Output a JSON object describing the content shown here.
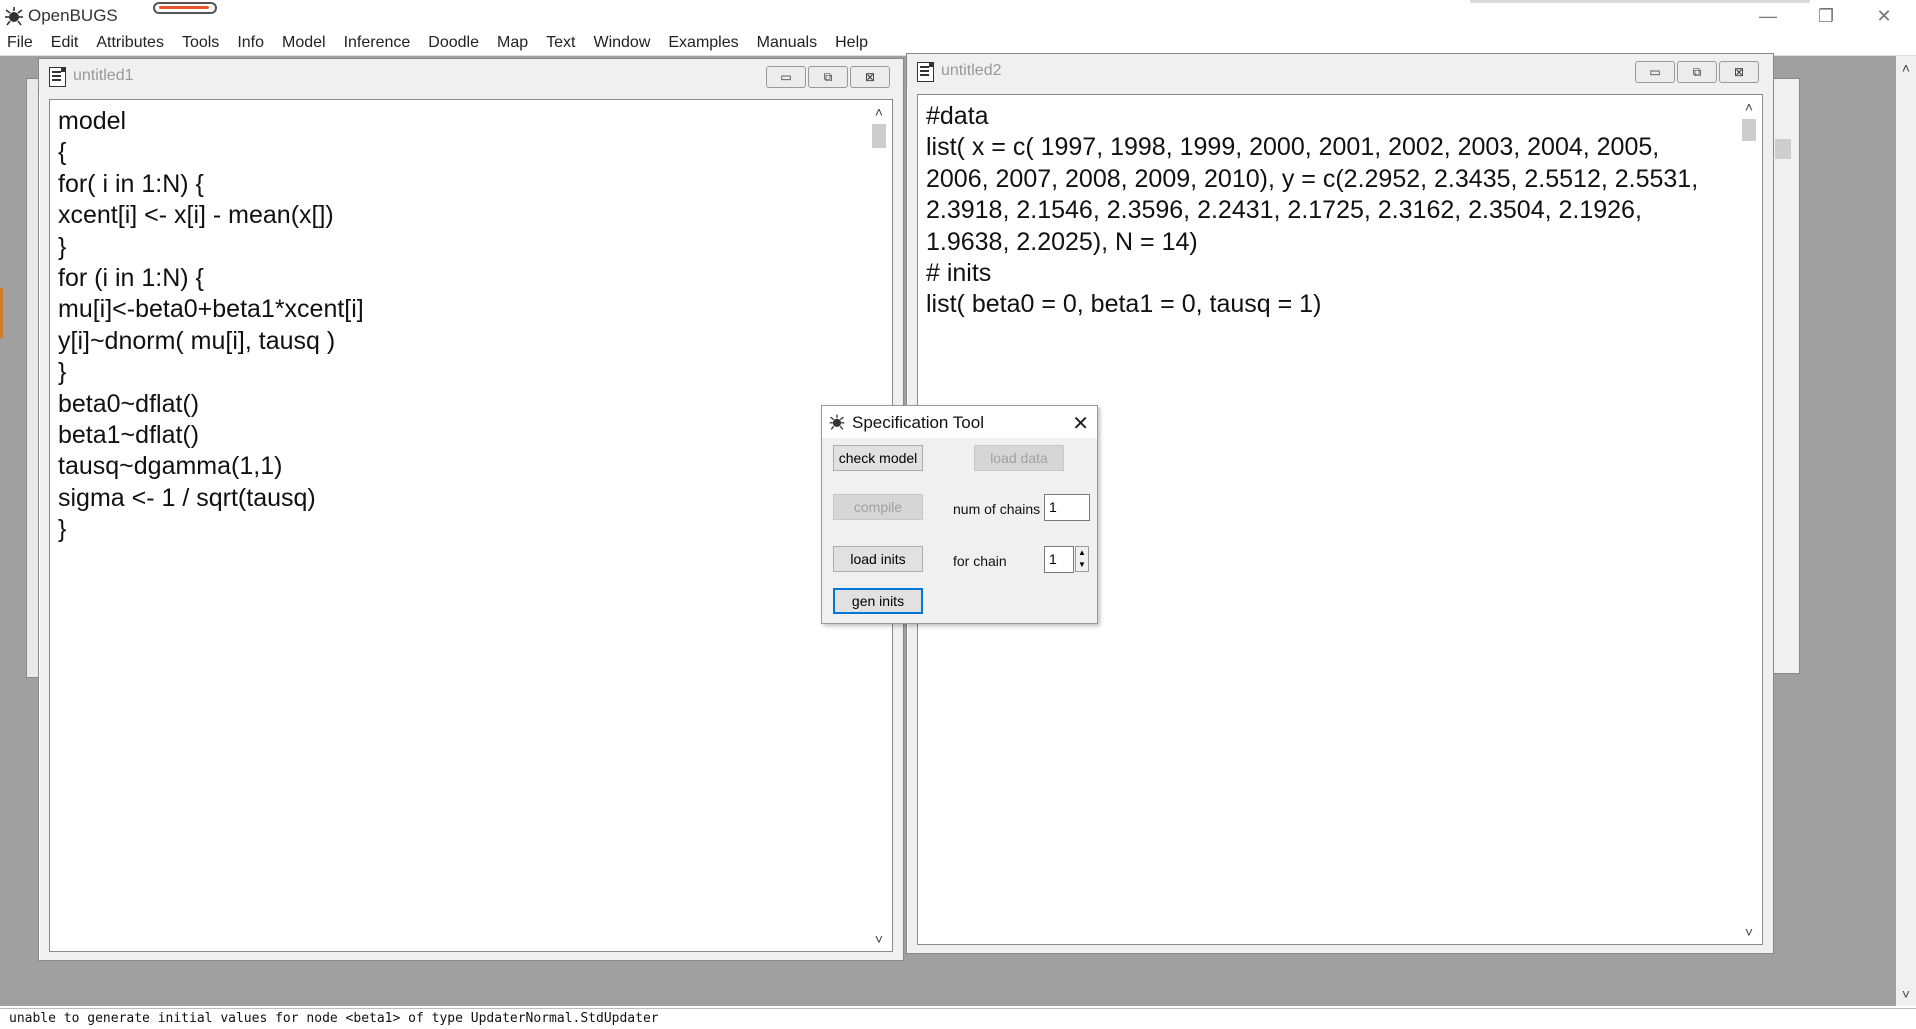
{
  "app": {
    "title": "OpenBUGS",
    "window_controls": {
      "minimize": "—",
      "restore": "❐",
      "close": "✕"
    }
  },
  "menubar": {
    "items": [
      "File",
      "Edit",
      "Attributes",
      "Tools",
      "Info",
      "Model",
      "Inference",
      "Doodle",
      "Map",
      "Text",
      "Window",
      "Examples",
      "Manuals",
      "Help"
    ]
  },
  "windows": {
    "untitled1": {
      "title": "untitled1",
      "code": "model\n{\nfor( i in 1:N) {\nxcent[i] <- x[i] - mean(x[])\n}\nfor (i in 1:N) {\nmu[i]<-beta0+beta1*xcent[i]\ny[i]~dnorm( mu[i], tausq )\n}\nbeta0~dflat()\nbeta1~dflat()\ntausq~dgamma(1,1)\nsigma <- 1 / sqrt(tausq)\n}"
    },
    "untitled2": {
      "title": "untitled2",
      "code": "#data\nlist( x = c( 1997, 1998, 1999, 2000, 2001, 2002, 2003, 2004, 2005, 2006, 2007, 2008, 2009, 2010), y = c(2.2952, 2.3435, 2.5512, 2.5531, 2.3918, 2.1546, 2.3596, 2.2431, 2.1725, 2.3162, 2.3504, 2.1926, 1.9638, 2.2025), N = 14)\n# inits\nlist( beta0 = 0, beta1 = 0, tausq = 1)"
    },
    "mdi_buttons": {
      "minimize": "▭",
      "restore": "⧉",
      "close": "⊠"
    }
  },
  "spec_tool": {
    "title": "Specification Tool",
    "close": "✕",
    "check_model": "check model",
    "load_data": "load data",
    "compile": "compile",
    "num_chains_label": "num of chains",
    "num_chains_value": "1",
    "load_inits": "load inits",
    "for_chain_label": "for chain",
    "for_chain_value": "1",
    "gen_inits": "gen inits"
  },
  "statusbar": {
    "message": "unable to generate initial values for node <beta1> of type UpdaterNormal.StdUpdater"
  },
  "colors": {
    "workspace": "#a0a0a0",
    "focus": "#0078d7"
  }
}
